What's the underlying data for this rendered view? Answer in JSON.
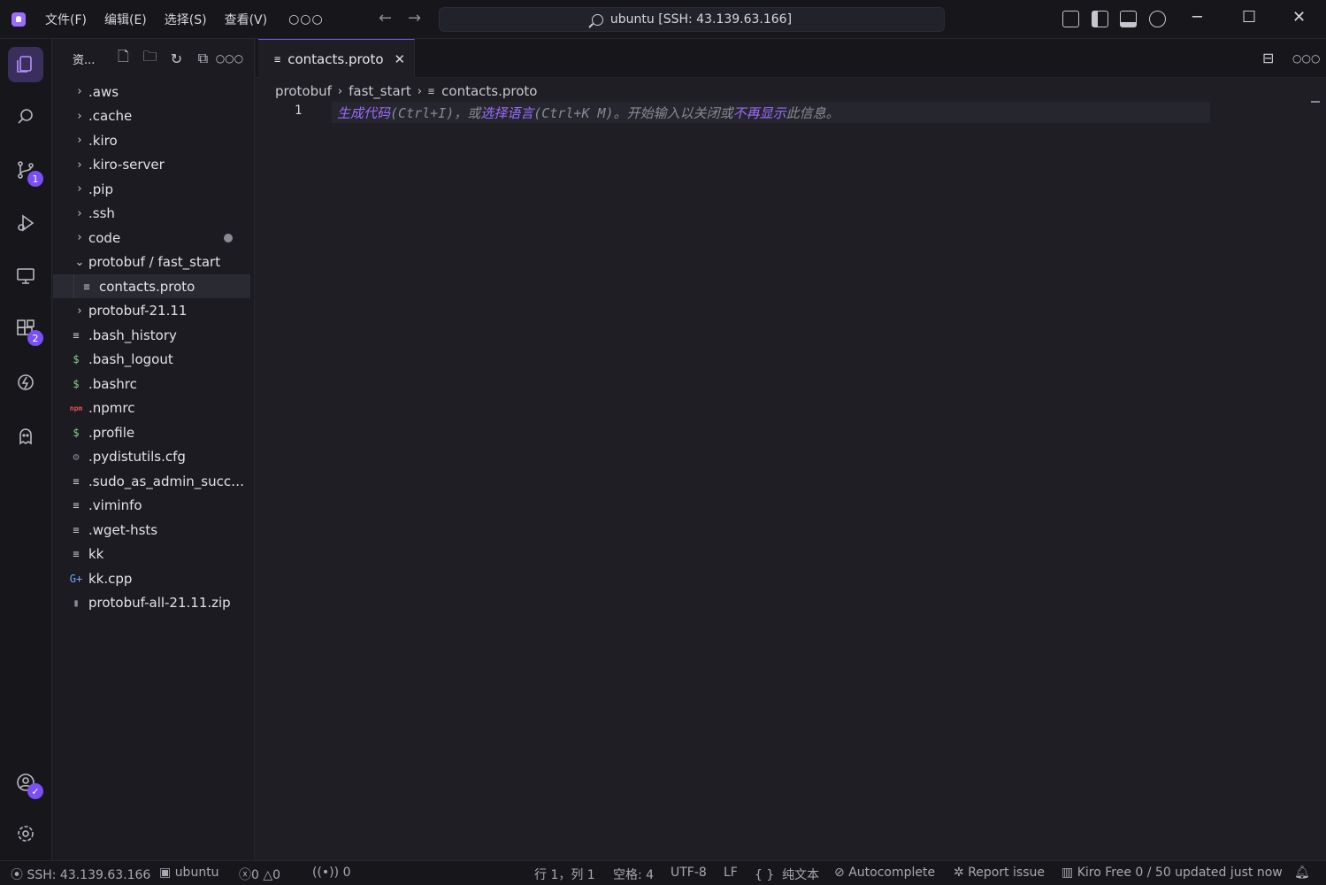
{
  "menu": [
    "文件(F)",
    "编辑(E)",
    "选择(S)",
    "查看(V)"
  ],
  "search": {
    "label": "ubuntu [SSH: 43.139.63.166]"
  },
  "activity": {
    "scm_badge": "1",
    "extensions_badge": "2"
  },
  "sidebar": {
    "title": "资...",
    "tree": [
      {
        "name": ".aws",
        "type": "folder",
        "icon": "chevron-right"
      },
      {
        "name": ".cache",
        "type": "folder",
        "icon": "chevron-right"
      },
      {
        "name": ".kiro",
        "type": "folder",
        "icon": "chevron-right"
      },
      {
        "name": ".kiro-server",
        "type": "folder",
        "icon": "chevron-right"
      },
      {
        "name": ".pip",
        "type": "folder",
        "icon": "chevron-right"
      },
      {
        "name": ".ssh",
        "type": "folder",
        "icon": "chevron-right"
      },
      {
        "name": "code",
        "type": "folder",
        "icon": "chevron-right",
        "modified": true
      },
      {
        "name": "protobuf / fast_start",
        "type": "folder",
        "icon": "chevron-down"
      },
      {
        "name": "contacts.proto",
        "type": "file",
        "icon": "lines-icon",
        "selected": true,
        "indent": 1
      },
      {
        "name": "protobuf-21.11",
        "type": "folder",
        "icon": "chevron-right"
      },
      {
        "name": ".bash_history",
        "type": "file",
        "icon": "lines-icon"
      },
      {
        "name": ".bash_logout",
        "type": "file",
        "icon": "dollar-icon"
      },
      {
        "name": ".bashrc",
        "type": "file",
        "icon": "dollar-icon"
      },
      {
        "name": ".npmrc",
        "type": "file",
        "icon": "npm-icon"
      },
      {
        "name": ".profile",
        "type": "file",
        "icon": "dollar-icon"
      },
      {
        "name": ".pydistutils.cfg",
        "type": "file",
        "icon": "gear-icon"
      },
      {
        "name": ".sudo_as_admin_succes...",
        "type": "file",
        "icon": "lines-icon"
      },
      {
        "name": ".viminfo",
        "type": "file",
        "icon": "lines-icon"
      },
      {
        "name": ".wget-hsts",
        "type": "file",
        "icon": "lines-icon"
      },
      {
        "name": "kk",
        "type": "file",
        "icon": "lines-icon"
      },
      {
        "name": "kk.cpp",
        "type": "file",
        "icon": "cpp-icon"
      },
      {
        "name": "protobuf-all-21.11.zip",
        "type": "file",
        "icon": "zip-icon"
      }
    ]
  },
  "editor": {
    "tab_label": "contacts.proto",
    "breadcrumb": [
      "protobuf",
      "fast_start",
      "contacts.proto"
    ],
    "line_number": "1",
    "hint": {
      "link1": "生成代码",
      "text1": "(Ctrl+I)，或",
      "link2": "选择语言",
      "text2": "(Ctrl+K M)。开始输入以关闭或",
      "link3": "不再显示",
      "text3": "此信息。"
    }
  },
  "status": {
    "remote": "SSH: 43.139.63.166",
    "user": "ubuntu",
    "errors": "0",
    "warnings": "0",
    "ports": "0",
    "position": "行 1，列 1",
    "spaces": "空格: 4",
    "encoding": "UTF-8",
    "eol": "LF",
    "language": "纯文本",
    "autocomplete": "Autocomplete",
    "report": "Report issue",
    "plan": "Kiro Free 0 / 50 updated just now"
  },
  "colors": {
    "accent": "#7a4ff5",
    "link": "#9b6cff"
  }
}
